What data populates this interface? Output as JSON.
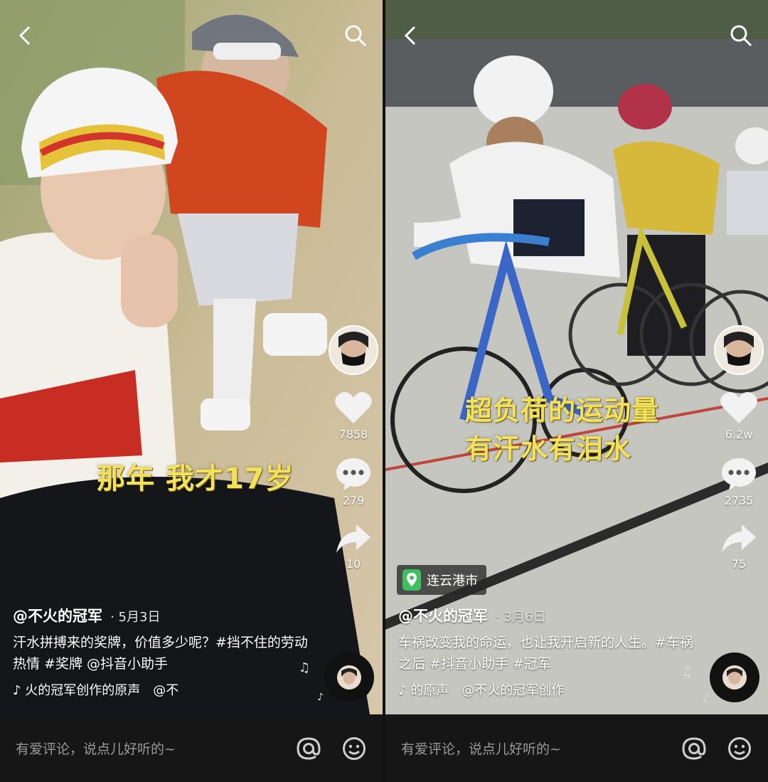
{
  "left": {
    "overlay_text": "那年 我才17岁",
    "author": "@不火的冠军",
    "date": "· 5月3日",
    "caption": "汗水拼搏来的奖牌，价值多少呢？#挡不住的劳动热情 #奖牌 @抖音小助手",
    "music_1": "♪ 火的冠军创作的原声",
    "music_2": "@不",
    "likes": "7858",
    "comments": "279",
    "shares": "10",
    "comment_placeholder": "有爱评论，说点儿好听的~"
  },
  "right": {
    "overlay_line1": "超负荷的运动量",
    "overlay_line2": "有汗水有泪水",
    "location": "连云港市",
    "author": "@不火的冠军",
    "date": "· 3月6日",
    "caption": "车祸改变我的命运，也让我开启新的人生。#车祸之后 #抖音小助手 #冠军",
    "music_1": "♪ 的原声",
    "music_2": "@不火的冠军创作",
    "likes": "6.2w",
    "comments": "2735",
    "shares": "75",
    "comment_placeholder": "有爱评论，说点儿好听的~"
  },
  "icons": {
    "back": "back-arrow-icon",
    "search": "search-icon",
    "like": "heart-icon",
    "comment": "comment-bubble-icon",
    "share": "share-arrow-icon",
    "mention": "at-icon",
    "emoji": "emoji-icon",
    "location": "location-pin-icon",
    "music": "music-note-icon"
  },
  "colors": {
    "overlay_yellow": "#f4e15a",
    "location_green": "#3fbf5f",
    "bar_bg": "#161616"
  }
}
